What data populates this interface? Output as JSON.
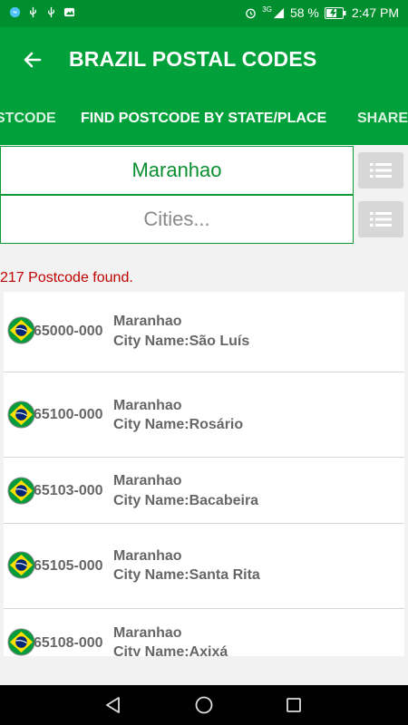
{
  "status_bar": {
    "battery_percent": "58 %",
    "time": "2:47 PM",
    "network": "3G",
    "icons": [
      "messenger-icon",
      "usb-icon",
      "usb-icon",
      "photo-icon",
      "alarm-icon",
      "signal-icon",
      "battery-charging-icon"
    ]
  },
  "app_bar": {
    "title": "BRAZIL POSTAL CODES",
    "back_icon": "arrow-left-icon"
  },
  "tabs": [
    {
      "label": "STCODE"
    },
    {
      "label": "FIND POSTCODE BY STATE/PLACE"
    },
    {
      "label": "SHARE"
    }
  ],
  "search": {
    "state_value": "Maranhao",
    "city_placeholder": "Cities..."
  },
  "result_text": "217 Postcode found.",
  "results": [
    {
      "code": "65000-000",
      "state": "Maranhao",
      "city": "City Name:São Luís"
    },
    {
      "code": "65100-000",
      "state": "Maranhao",
      "city": "City Name:Rosário"
    },
    {
      "code": "65103-000",
      "state": "Maranhao",
      "city": "City Name:Bacabeira"
    },
    {
      "code": "65105-000",
      "state": "Maranhao",
      "city": "City Name:Santa Rita"
    },
    {
      "code": "65108-000",
      "state": "Maranhao",
      "city": "City Name:Axixá"
    }
  ],
  "colors": {
    "app_bar": "#00a13a",
    "status_bar": "#008f2e",
    "accent_text": "#0a8f30",
    "result_count": "#c00000"
  }
}
